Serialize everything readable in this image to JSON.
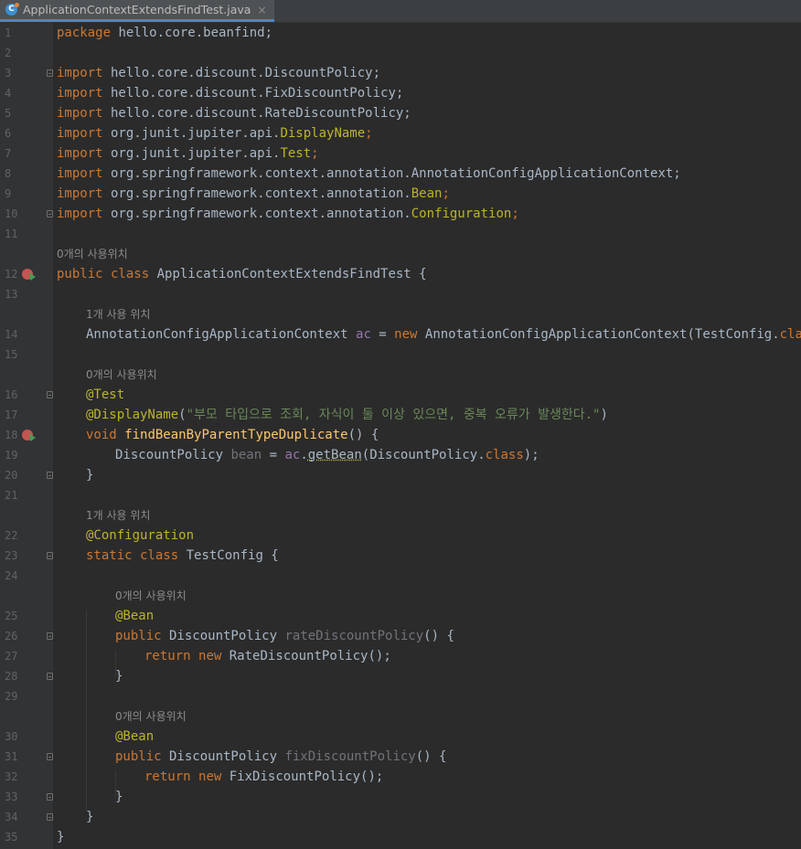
{
  "tab": {
    "filename": "ApplicationContextExtendsFindTest.java",
    "icon": "java-class-icon",
    "close_glyph": "×"
  },
  "hints": {
    "zero_usages_a": "0개의 사용위치",
    "one_usage": "1개 사용 위치"
  },
  "code": {
    "l1_kw": "package",
    "l1_rest": " hello.core.beanfind;",
    "imp": "import",
    "l3": " hello.core.discount.DiscountPolicy;",
    "l4": " hello.core.discount.FixDiscountPolicy;",
    "l5": " hello.core.discount.RateDiscountPolicy;",
    "l6_pkg": " org.junit.jupiter.api.",
    "l6_cls": "DisplayName",
    "l7_pkg": " org.junit.jupiter.api.",
    "l7_cls": "Test",
    "l8": " org.springframework.context.annotation.AnnotationConfigApplicationContext;",
    "l9_pkg": " org.springframework.context.annotation.",
    "l9_cls": "Bean",
    "l10_pkg": " org.springframework.context.annotation.",
    "l10_cls": "Configuration",
    "semi": ";",
    "l12_kw": "public class",
    "l12_rest": " ApplicationContextExtendsFindTest {",
    "l14_type": "AnnotationConfigApplicationContext ",
    "l14_var": "ac",
    "l14_eq": " = ",
    "l14_new": "new",
    "l14_rest": " AnnotationConfigApplicationContext(TestConfig.",
    "l14_class": "class",
    "l14_end": ");",
    "l16": "@Test",
    "l17_ann": "@DisplayName",
    "l17_open": "(",
    "l17_str": "\"부모 타입으로 조회, 자식이 둘 이상 있으면, 중복 오류가 발생한다.\"",
    "l17_close": ")",
    "l18_kw": "void",
    "l18_fn": "findBeanByParentTypeDuplicate",
    "l18_rest": "() {",
    "l19_type": "DiscountPolicy ",
    "l19_var": "bean",
    "l19_eq": " = ",
    "l19_ac": "ac",
    "l19_dot": ".",
    "l19_call": "getBean",
    "l19_rest": "(DiscountPolicy.",
    "l19_class": "class",
    "l19_end": ");",
    "close_brace": "}",
    "l22": "@Configuration",
    "l23_kw": "static class",
    "l23_rest": " TestConfig {",
    "bean_ann": "@Bean",
    "public_kw": "public",
    "l26_type": " DiscountPolicy ",
    "l26_fn": "rateDiscountPolicy",
    "l26_rest": "() {",
    "return_kw": "return",
    "new_kw": "new",
    "l27_rest": " RateDiscountPolicy();",
    "l31_type": " DiscountPolicy ",
    "l31_fn": "fixDiscountPolicy",
    "l31_rest": "() {",
    "l32_rest": " FixDiscountPolicy();"
  },
  "line_numbers": [
    "1",
    "2",
    "3",
    "4",
    "5",
    "6",
    "7",
    "8",
    "9",
    "10",
    "11",
    "12",
    "13",
    "14",
    "15",
    "16",
    "17",
    "18",
    "19",
    "20",
    "21",
    "22",
    "23",
    "24",
    "25",
    "26",
    "27",
    "28",
    "29",
    "30",
    "31",
    "32",
    "33",
    "34",
    "35"
  ]
}
